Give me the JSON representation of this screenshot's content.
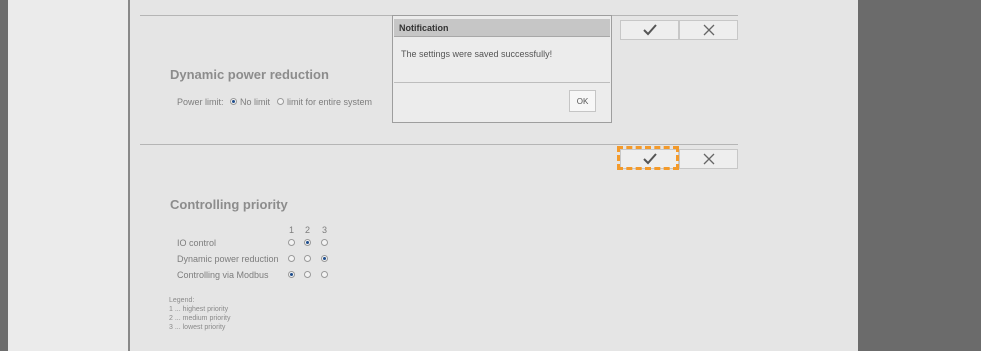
{
  "sections": {
    "power_reduction": {
      "heading": "Dynamic power reduction",
      "power_limit_label": "Power limit:",
      "options": [
        "No limit",
        "limit for entire system"
      ],
      "selected": "No limit"
    },
    "controlling_priority": {
      "heading": "Controlling priority",
      "columns": [
        "1",
        "2",
        "3"
      ],
      "rows": [
        {
          "label": "IO control",
          "selected": "2"
        },
        {
          "label": "Dynamic power reduction",
          "selected": "3"
        },
        {
          "label": "Controlling via Modbus",
          "selected": "1"
        }
      ],
      "legend_title": "Legend:",
      "legend_items": [
        "1 ... highest priority",
        "2 ... medium priority",
        "3 ... lowest priority"
      ]
    }
  },
  "actions": {
    "save_icon": "checkmark-icon",
    "cancel_icon": "close-icon"
  },
  "dialog": {
    "title": "Notification",
    "message": "The settings were saved successfully!",
    "ok_label": "OK"
  },
  "colors": {
    "highlight": "#f39a2b",
    "radio_selected": "#1e4d8c"
  }
}
